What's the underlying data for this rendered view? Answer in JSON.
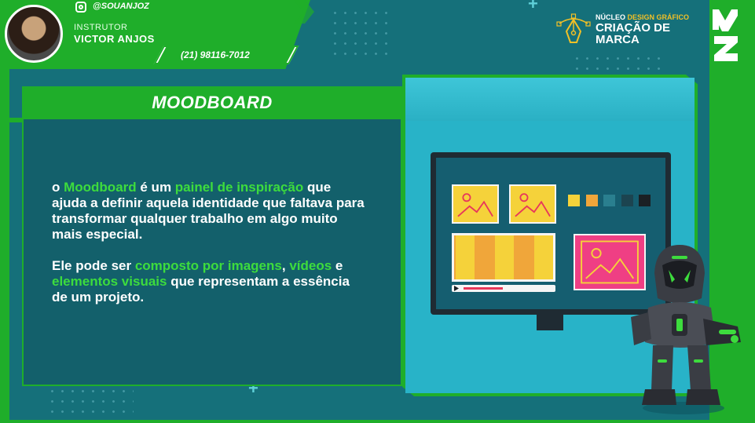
{
  "header": {
    "social_handle": "@SOUANJOZ",
    "instructor_label": "INSTRUTOR",
    "instructor_name": "VICTOR ANJOS",
    "phone": "(21) 98116-7012"
  },
  "logo": {
    "prefix_plain": "NÚCLEO",
    "prefix_accent": "DESIGN GRÁFICO",
    "title": "CRIAÇÃO DE MARCA"
  },
  "panel": {
    "title": "MOODBOARD",
    "paragraph1": [
      {
        "text": "o ",
        "highlight": false
      },
      {
        "text": "Moodboard",
        "highlight": true
      },
      {
        "text": " é um ",
        "highlight": false
      },
      {
        "text": "painel de inspiração",
        "highlight": true
      },
      {
        "text": " que ajuda a definir aquela identidade que faltava para transformar qualquer trabalho em algo muito mais especial.",
        "highlight": false
      }
    ],
    "paragraph2": [
      {
        "text": "Ele pode ser ",
        "highlight": false
      },
      {
        "text": "composto por imagens",
        "highlight": true
      },
      {
        "text": ", ",
        "highlight": false
      },
      {
        "text": "vídeos",
        "highlight": true
      },
      {
        "text": " e ",
        "highlight": false
      },
      {
        "text": "elementos visuais",
        "highlight": true
      },
      {
        "text": " que representam a essência de um projeto.",
        "highlight": false
      }
    ]
  },
  "colors": {
    "brand_green": "#1fae2a",
    "highlight_green": "#3ddc3d",
    "background_teal": "#15707a",
    "swatches": [
      "#f5d23a",
      "#f0a63a",
      "#2a7f8f",
      "#1c4450",
      "#1b2024"
    ]
  },
  "icons": [
    "instagram-icon",
    "pen-tool-icon",
    "brand-logo-icon",
    "image-icon",
    "play-icon"
  ]
}
